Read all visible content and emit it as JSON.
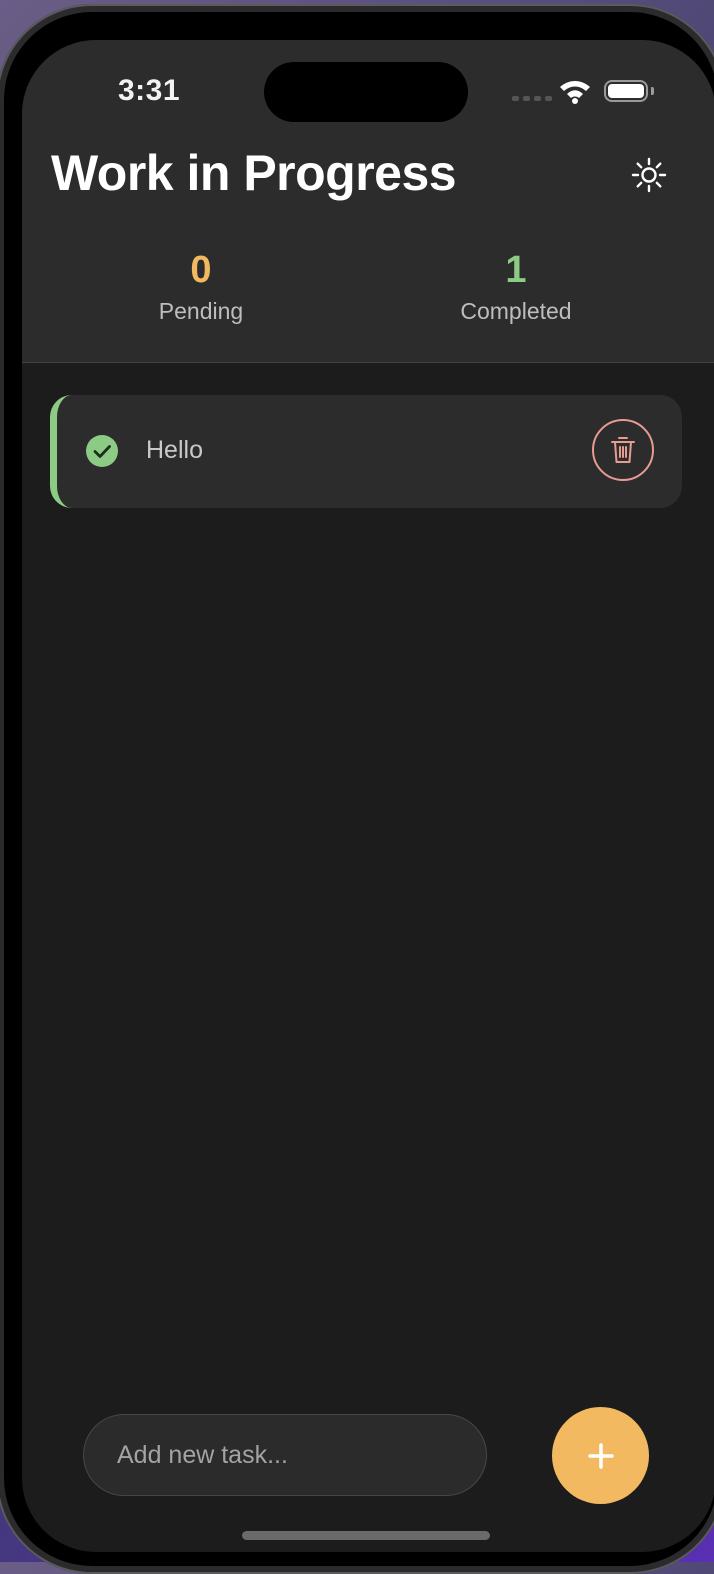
{
  "status_bar": {
    "time": "3:31",
    "wifi_icon": "wifi-icon",
    "battery_icon": "battery-icon"
  },
  "header": {
    "title": "Work in Progress",
    "theme_icon": "sun-icon"
  },
  "stats": {
    "pending": {
      "count": "0",
      "label": "Pending",
      "color": "#f2b960"
    },
    "completed": {
      "count": "1",
      "label": "Completed",
      "color": "#8ccb84"
    }
  },
  "tasks": [
    {
      "text": "Hello",
      "completed": true,
      "status_icon": "check-circle-icon",
      "delete_icon": "trash-icon"
    }
  ],
  "composer": {
    "placeholder": "Add new task...",
    "add_icon": "plus-icon"
  },
  "colors": {
    "background": "#1c1c1c",
    "surface": "#2c2c2c",
    "accent": "#f2b960",
    "success": "#8ccb84",
    "danger": "#e89b91"
  }
}
